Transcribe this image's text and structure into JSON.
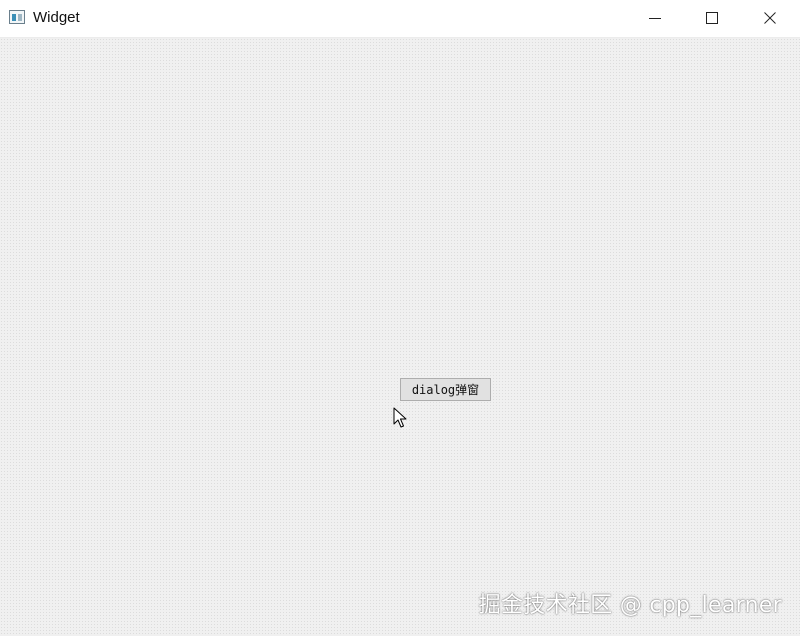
{
  "window": {
    "title": "Widget",
    "controls": {
      "minimize_icon": "minimize-icon",
      "maximize_icon": "maximize-icon",
      "close_icon": "close-icon"
    }
  },
  "content": {
    "dialog_button_label": "dialog弹窗"
  },
  "watermark": {
    "text": "掘金技术社区 @ cpp_learner"
  },
  "colors": {
    "client_background": "#f0f0f0",
    "button_face": "#e1e1e1",
    "button_border": "#adadad"
  }
}
